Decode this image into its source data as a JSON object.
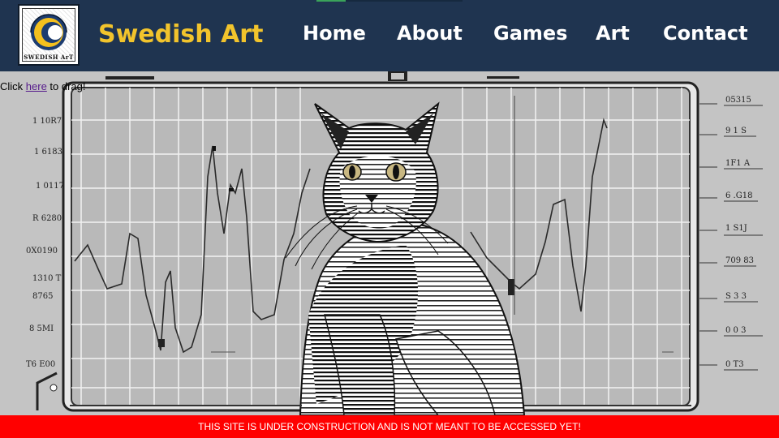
{
  "header": {
    "logo_caption": "SWEDISH ArT",
    "brand": "Swedish Art",
    "nav": [
      "Home",
      "About",
      "Games",
      "Art",
      "Contact"
    ]
  },
  "hero": {
    "drag_prefix": "Click ",
    "drag_link": "here",
    "drag_suffix": " to drag!",
    "left_labels": [
      "1 10R7",
      "1 6183",
      "1 0117",
      "R 6280",
      "0X0190",
      "1310 T",
      "8765",
      "8 5MI",
      "T6 E00"
    ],
    "right_labels": [
      "05315",
      "9 1 S",
      "1F1 A",
      "6 .G18",
      "1 S1J",
      "709 83",
      "S 3 3",
      "0 0 3",
      "0 T3"
    ]
  },
  "banner": {
    "text": "THIS SITE IS UNDER CONSTRUCTION AND IS NOT MEANT TO BE ACCESSED YET!"
  },
  "colors": {
    "header_bg": "#1f3450",
    "brand": "#f2c42c",
    "nav_text": "#ffffff",
    "banner_bg": "#ff0000",
    "link": "#551a8b"
  }
}
